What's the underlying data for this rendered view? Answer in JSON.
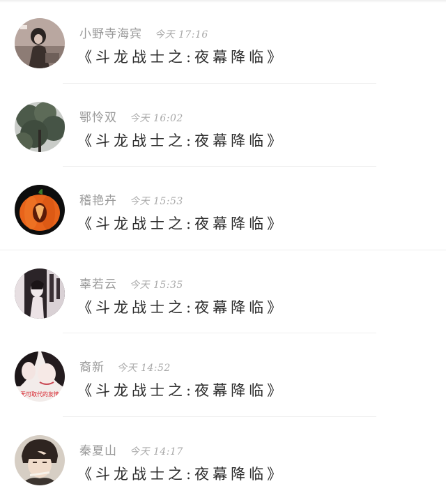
{
  "comments": [
    {
      "name": "小野寺海宾",
      "time": "今天 17:16",
      "text": "《斗龙战士之:夜幕降临》",
      "avatar": "avatar-photo-girl"
    },
    {
      "name": "鄂怜双",
      "time": "今天 16:02",
      "text": "《斗龙战士之:夜幕降临》",
      "avatar": "avatar-tree-sky"
    },
    {
      "name": "稽艳卉",
      "time": "今天 15:53",
      "text": "《斗龙战士之:夜幕降临》",
      "avatar": "avatar-pumpkin"
    },
    {
      "name": "辜若云",
      "time": "今天 15:35",
      "text": "《斗龙战士之:夜幕降临》",
      "avatar": "avatar-anime-bw"
    },
    {
      "name": "裔新",
      "time": "今天 14:52",
      "text": "《斗龙战士之:夜幕降临》",
      "avatar": "avatar-anime-girls",
      "avatar_text": "无可取代的友情"
    },
    {
      "name": "秦夏山",
      "time": "今天 14:17",
      "text": "《斗龙战士之:夜幕降临》",
      "avatar": "avatar-anime-boy"
    }
  ],
  "colors": {
    "name": "#9a9a9a",
    "text": "#2b2b2b",
    "separator": "#eeeeee",
    "pumpkin": "#e8641b"
  }
}
